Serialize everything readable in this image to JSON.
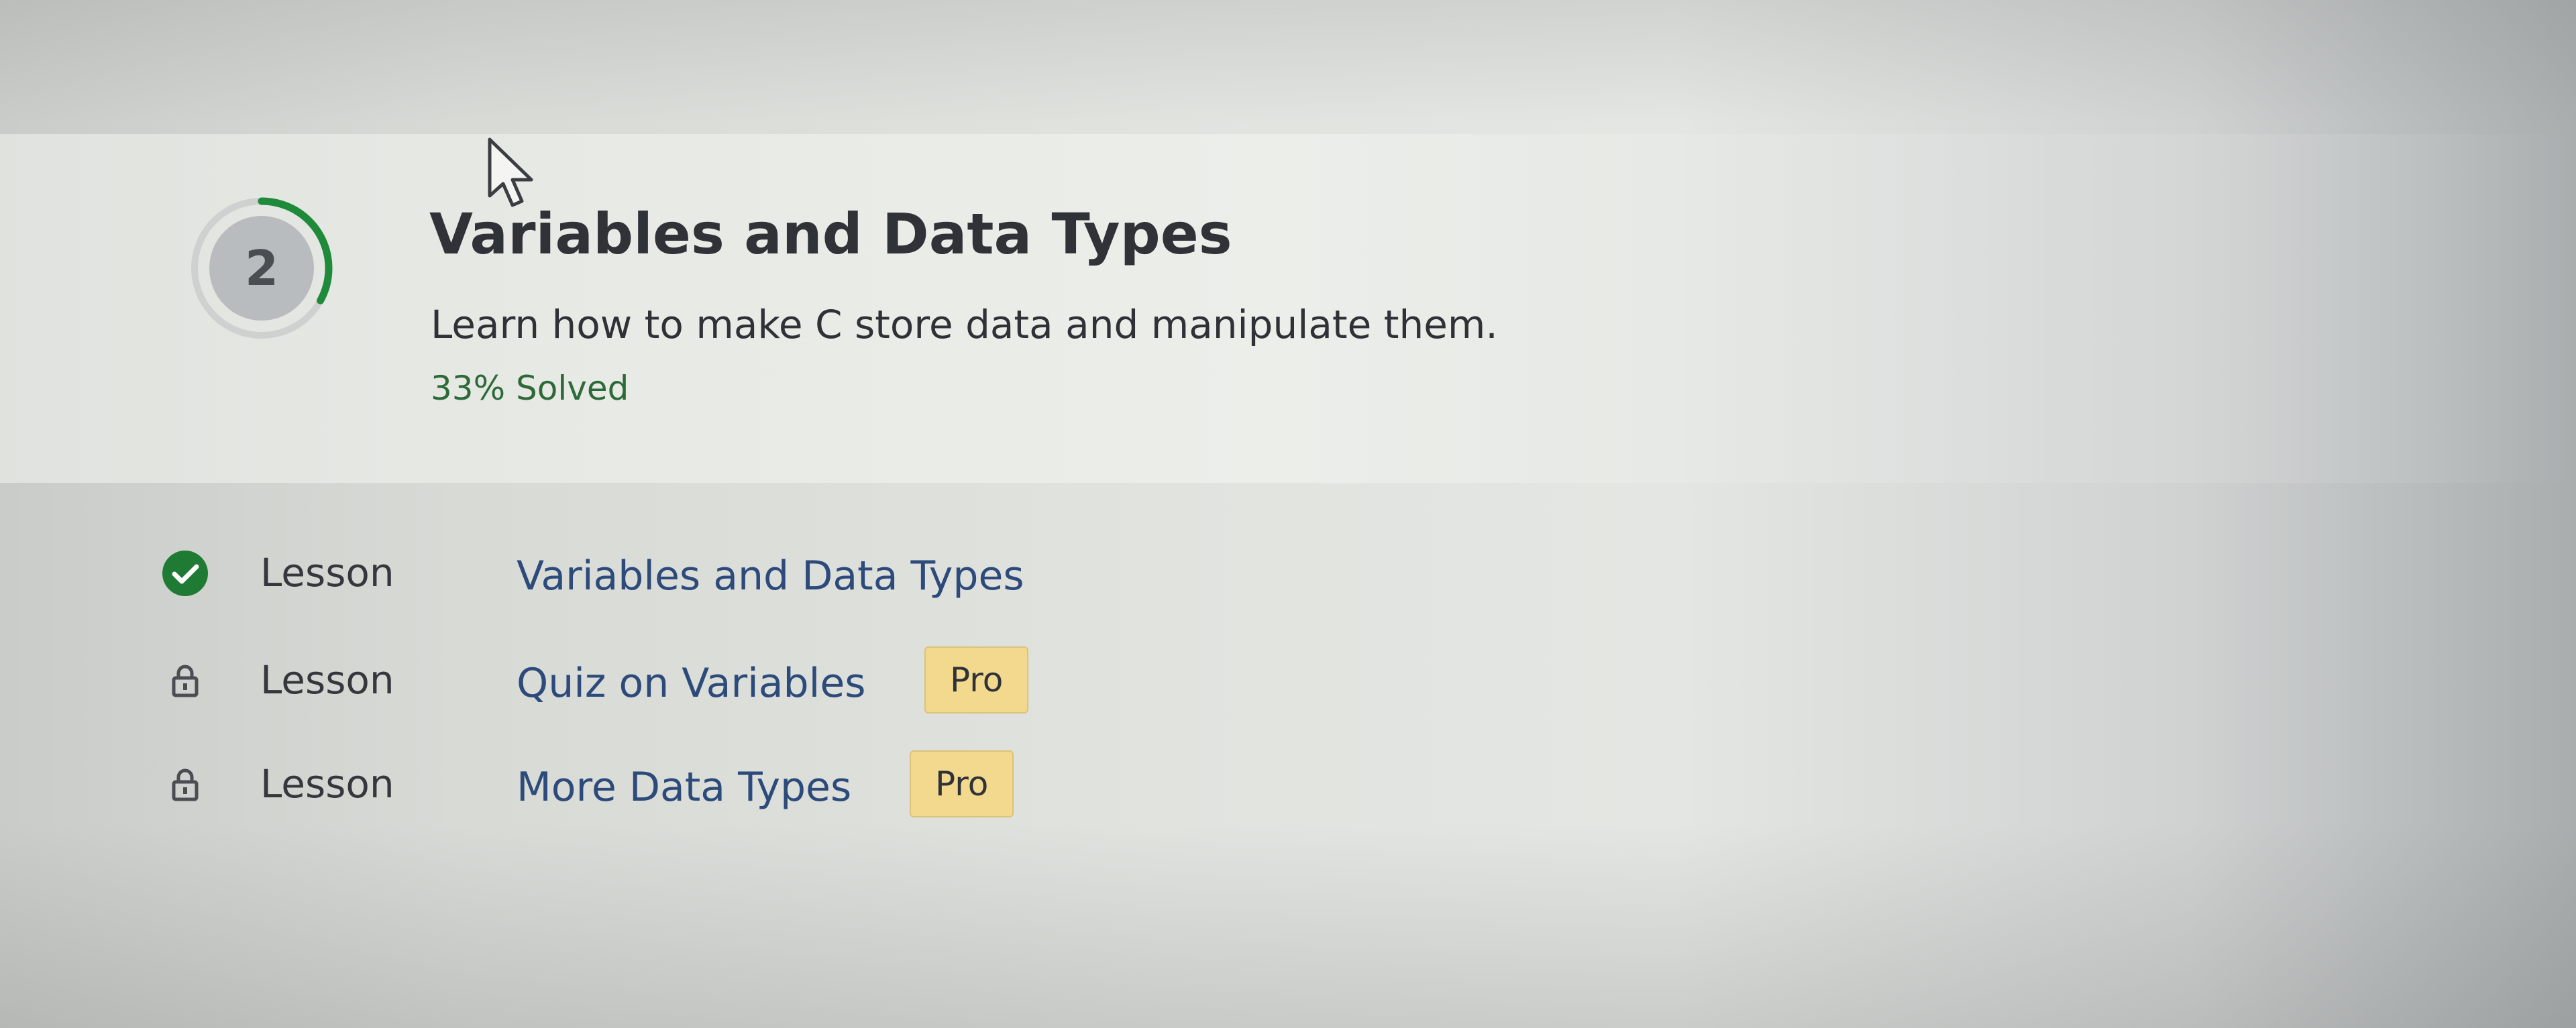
{
  "module": {
    "number": "2",
    "title": "Variables and Data Types",
    "description": "Learn how to make C store data and manipulate them.",
    "progress_text": "33% Solved",
    "progress_fraction": 0.33
  },
  "lessons": [
    {
      "type": "Lesson",
      "title": "Variables and Data Types",
      "status_icon": "check-circle-icon",
      "locked": false,
      "badge": ""
    },
    {
      "type": "Lesson",
      "title": "Quiz on Variables",
      "status_icon": "lock-icon",
      "locked": true,
      "badge": "Pro"
    },
    {
      "type": "Lesson",
      "title": "More Data Types",
      "status_icon": "lock-icon",
      "locked": true,
      "badge": "Pro"
    }
  ],
  "colors": {
    "progress_green": "#1e8a3a",
    "check_green": "#1f7a34",
    "pro_badge": "#f2d98e",
    "link_blue": "#2c4a7a"
  }
}
